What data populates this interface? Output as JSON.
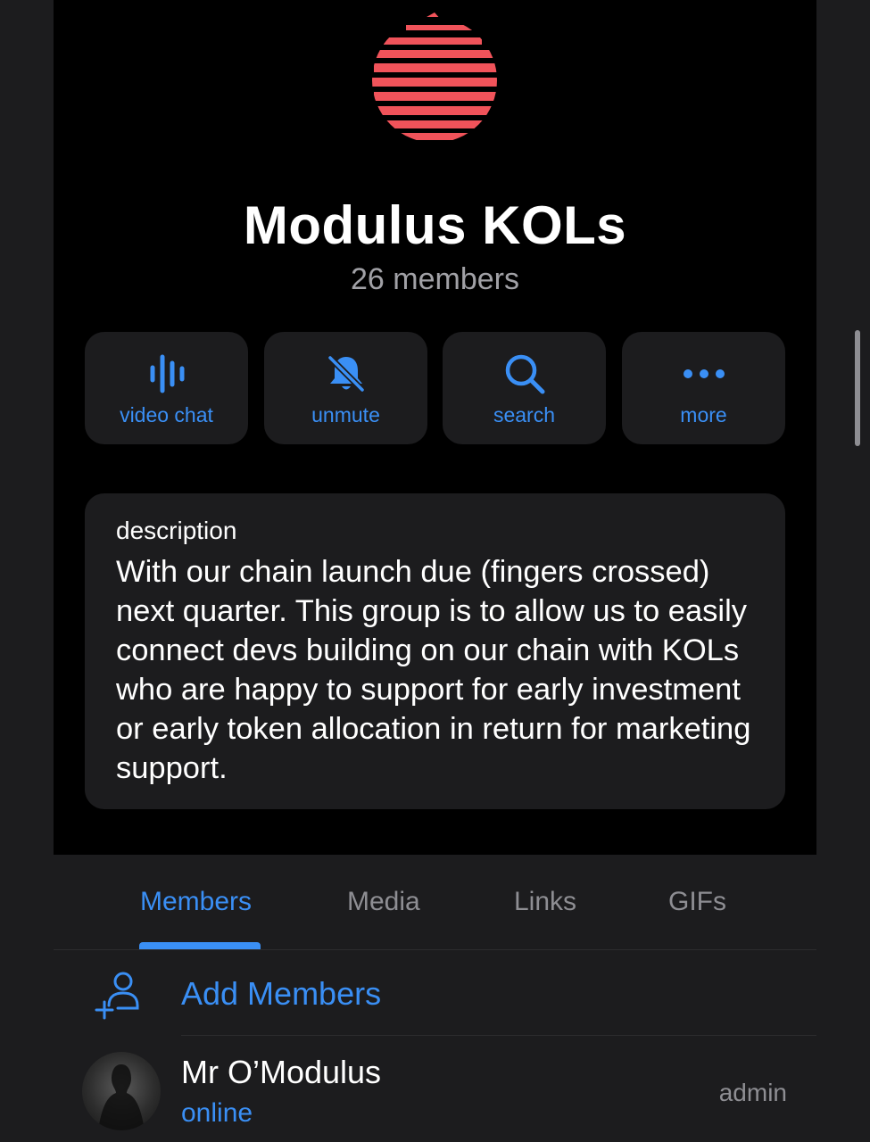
{
  "colors": {
    "accent": "#3a8ff5",
    "logo": "#f0535a",
    "background": "#000000",
    "card": "#1c1c1e",
    "secondary_text": "#a1a1a6"
  },
  "group": {
    "title": "Modulus KOLs",
    "members_count": "26 members"
  },
  "actions": [
    {
      "label": "video chat",
      "icon": "sound-bars-icon"
    },
    {
      "label": "unmute",
      "icon": "bell-slash-icon"
    },
    {
      "label": "search",
      "icon": "magnifier-icon"
    },
    {
      "label": "more",
      "icon": "ellipsis-icon"
    }
  ],
  "description": {
    "heading": "description",
    "text": "With our chain launch due (fingers crossed) next quarter. This group is to allow us to easily connect devs building on our chain with KOLs who are happy to support for early investment or early token allocation in return for marketing support."
  },
  "tabs": [
    {
      "label": "Members",
      "active": true
    },
    {
      "label": "Media",
      "active": false
    },
    {
      "label": "Links",
      "active": false
    },
    {
      "label": "GIFs",
      "active": false
    }
  ],
  "add_members": {
    "label": "Add Members",
    "icon": "add-person-icon"
  },
  "members": [
    {
      "name": "Mr O’Modulus",
      "status": "online",
      "role": "admin"
    }
  ]
}
